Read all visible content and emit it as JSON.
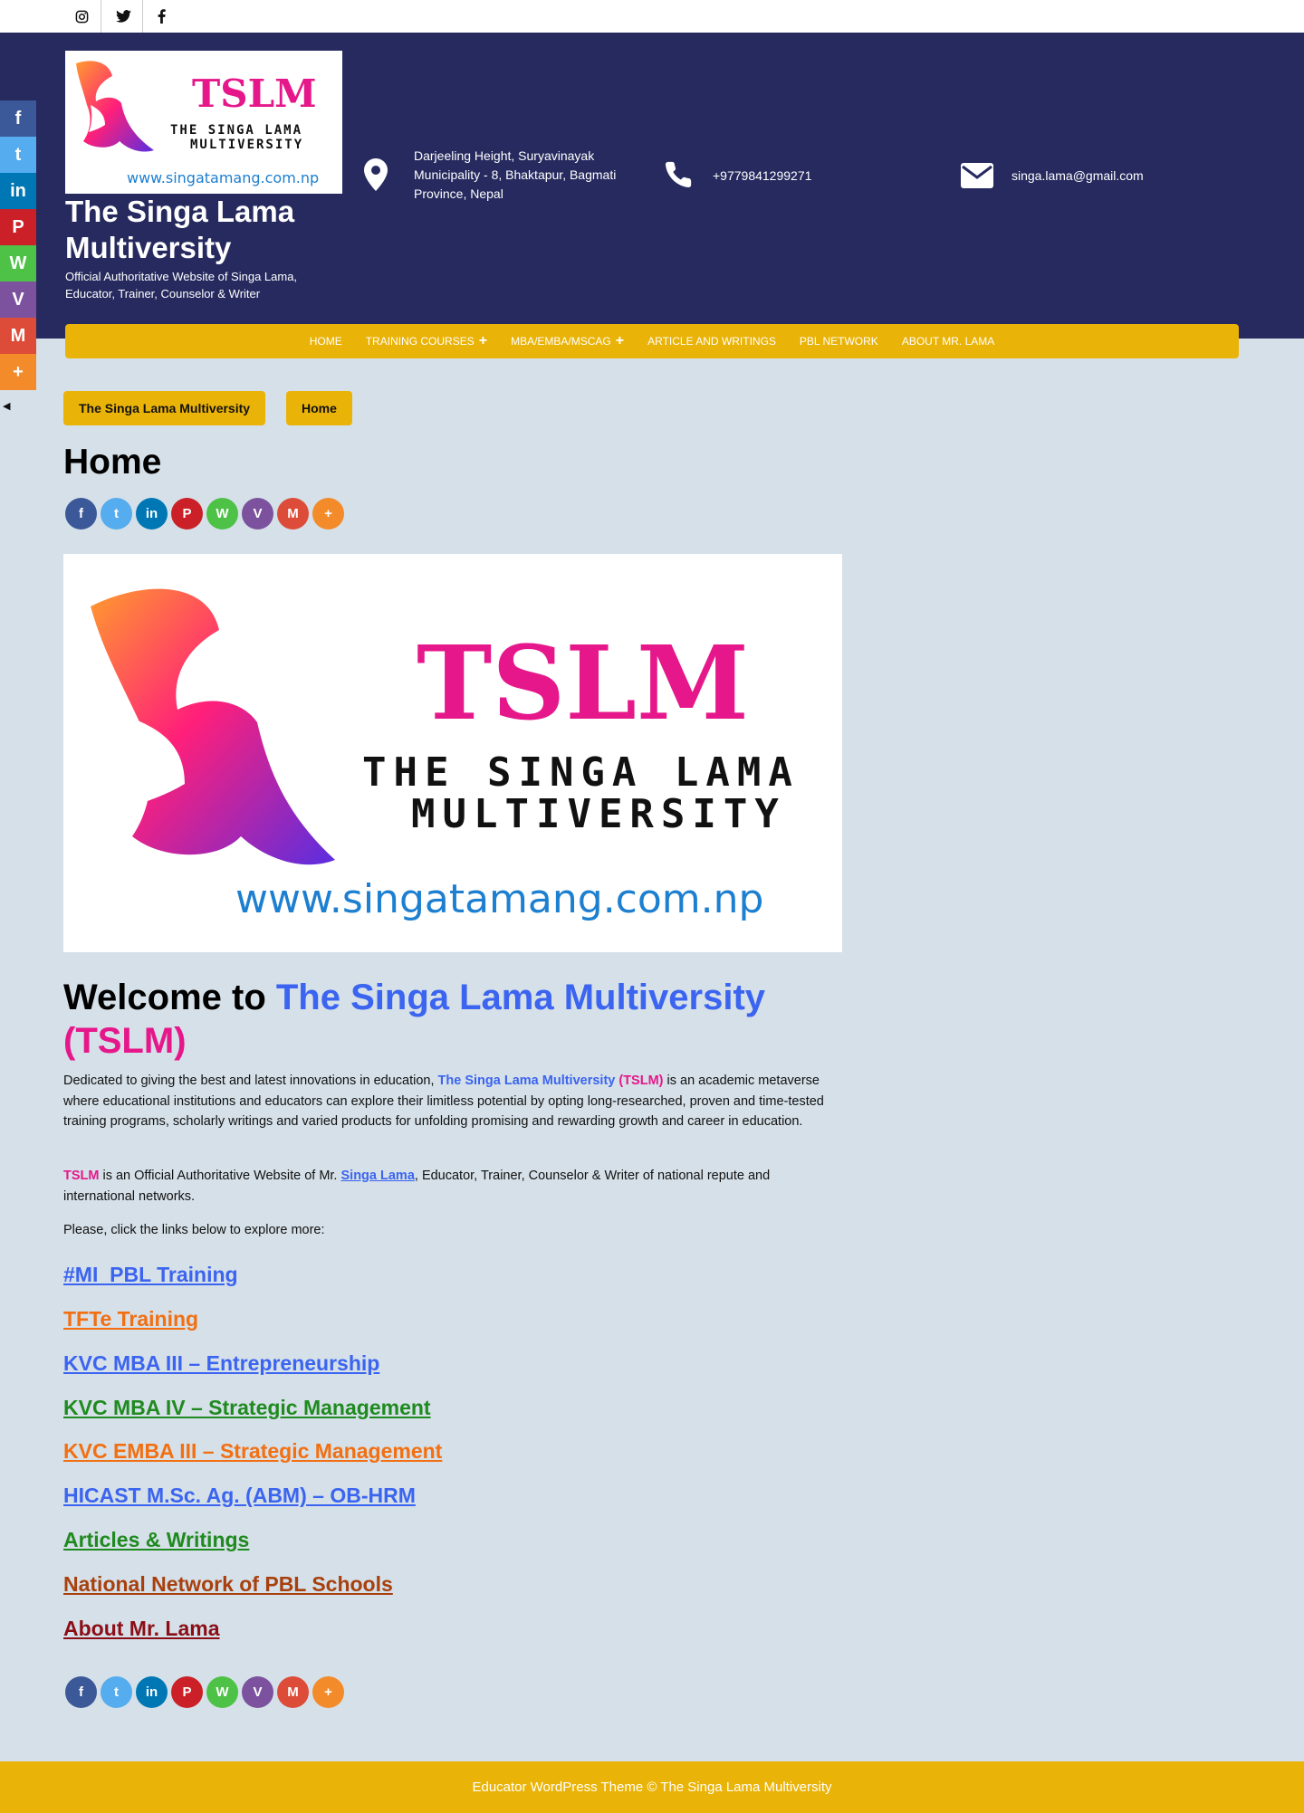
{
  "topbar": {
    "icons": [
      "instagram-icon",
      "twitter-icon",
      "facebook-icon"
    ]
  },
  "header": {
    "logo": {
      "mark": "TSLM",
      "line1": "THE SINGA LAMA",
      "line2": "MULTIVERSITY",
      "url": "www.singatamang.com.np"
    },
    "site_title": "The Singa Lama Multiversity",
    "tagline": "Official Authoritative Website of Singa Lama, Educator, Trainer, Counselor & Writer",
    "address": "Darjeeling Height, Suryavinayak Municipality - 8, Bhaktapur, Bagmati Province, Nepal",
    "phone": "+9779841299271",
    "email": "singa.lama@gmail.com",
    "colors": {
      "band": "#262a5e",
      "accent": "#eab308"
    }
  },
  "nav": {
    "items": [
      {
        "label": "HOME",
        "has_sub": false
      },
      {
        "label": "TRAINING COURSES",
        "has_sub": true
      },
      {
        "label": "MBA/EMBA/MSCAG",
        "has_sub": true
      },
      {
        "label": "ARTICLE AND WRITINGS",
        "has_sub": false
      },
      {
        "label": "PBL NETWORK",
        "has_sub": false
      },
      {
        "label": "ABOUT MR. LAMA",
        "has_sub": false
      }
    ]
  },
  "share": {
    "services": [
      {
        "name": "facebook",
        "glyph": "f",
        "color": "#3b5998"
      },
      {
        "name": "twitter",
        "glyph": "t",
        "color": "#55acee"
      },
      {
        "name": "linkedin",
        "glyph": "in",
        "color": "#0077b5"
      },
      {
        "name": "pinterest",
        "glyph": "P",
        "color": "#cb2027"
      },
      {
        "name": "whatsapp",
        "glyph": "W",
        "color": "#4dc247"
      },
      {
        "name": "viber",
        "glyph": "V",
        "color": "#7c529e"
      },
      {
        "name": "gmail",
        "glyph": "M",
        "color": "#dd4b39"
      },
      {
        "name": "more",
        "glyph": "+",
        "color": "#f38b2a"
      }
    ]
  },
  "breadcrumb": {
    "first": "The Singa Lama Multiversity",
    "second": "Home"
  },
  "page_title": "Home",
  "welcome": {
    "prefix": "Welcome to ",
    "name": "The Singa Lama Multiversity",
    "abbr": "(TSLM)"
  },
  "intro": {
    "p1_a": "Dedicated to giving the best and latest innovations in education, ",
    "p1_name": "The Singa Lama Multiversity",
    "p1_abbr": "(TSLM)",
    "p1_b": " is an academic metaverse where educational institutions and educators can explore their limitless potential by opting long-researched, proven and time-tested training programs, scholarly writings and varied products for unfolding promising and rewarding growth and career in education.",
    "p2_abbr": "TSLM",
    "p2_a": " is an Official Authoritative Website of Mr. ",
    "p2_link": "Singa Lama",
    "p2_b": ", Educator, Trainer, Counselor & Writer of national repute and international networks.",
    "p3": "Please, click the links below to explore more:"
  },
  "links": [
    {
      "label": "#MI_PBL Training",
      "color": "#3b64f0"
    },
    {
      "label": "TFTe Training",
      "color": "#f26f12"
    },
    {
      "label": "KVC MBA III – Entrepreneurship",
      "color": "#3b64f0"
    },
    {
      "label": "KVC MBA IV – Strategic Management",
      "color": "#1f8a1f"
    },
    {
      "label": "KVC EMBA III – Strategic Management",
      "color": "#f26f12"
    },
    {
      "label": "HICAST M.Sc. Ag. (ABM) – OB-HRM",
      "color": "#3b64f0"
    },
    {
      "label": "Articles & Writings",
      "color": "#1f8a1f"
    },
    {
      "label": "National Network of PBL Schools",
      "color": "#a8400e"
    },
    {
      "label": "About Mr. Lama",
      "color": "#8b0e16"
    }
  ],
  "footer": {
    "text": "Educator WordPress Theme © The Singa Lama Multiversity"
  }
}
